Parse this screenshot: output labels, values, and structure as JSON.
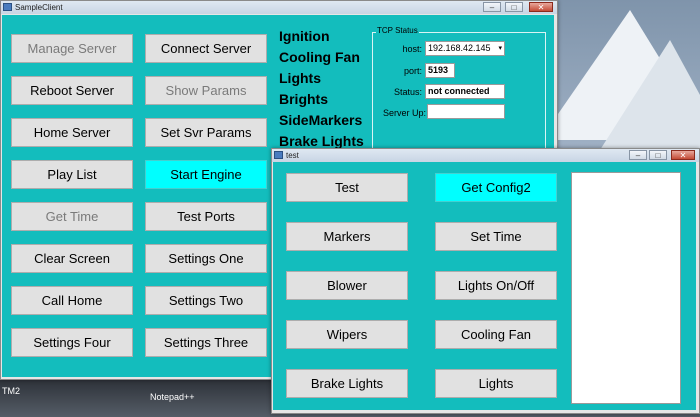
{
  "main_window": {
    "title": "SampleClient",
    "buttons": [
      {
        "label": "Manage Server",
        "state": "disabled"
      },
      {
        "label": "Connect Server",
        "state": "normal"
      },
      {
        "label": "Reboot Server",
        "state": "normal"
      },
      {
        "label": "Show Params",
        "state": "disabled"
      },
      {
        "label": "Home Server",
        "state": "normal"
      },
      {
        "label": "Set Svr Params",
        "state": "normal"
      },
      {
        "label": "Play List",
        "state": "normal"
      },
      {
        "label": "Start Engine",
        "state": "highlighted"
      },
      {
        "label": "Get Time",
        "state": "disabled"
      },
      {
        "label": "Test Ports",
        "state": "normal"
      },
      {
        "label": "Clear Screen",
        "state": "normal"
      },
      {
        "label": "Settings One",
        "state": "normal"
      },
      {
        "label": "Call Home",
        "state": "normal"
      },
      {
        "label": "Settings Two",
        "state": "normal"
      },
      {
        "label": "Settings Four",
        "state": "normal"
      },
      {
        "label": "Settings Three",
        "state": "normal"
      }
    ],
    "status_labels": [
      "Ignition",
      "Cooling Fan",
      "Lights",
      "Brights",
      "SideMarkers",
      "Brake Lights"
    ],
    "tcp_status": {
      "legend": "TCP Status",
      "host_label": "host:",
      "host_value": "192.168.42.145",
      "port_label": "port:",
      "port_value": "5193",
      "status_label": "Status:",
      "status_value": "not connected",
      "server_up_label": "Server Up:",
      "server_up_value": ""
    }
  },
  "test_window": {
    "title": "test",
    "buttons": [
      {
        "label": "Test",
        "state": "normal"
      },
      {
        "label": "Get Config2",
        "state": "highlighted"
      },
      {
        "label": "Markers",
        "state": "normal"
      },
      {
        "label": "Set Time",
        "state": "normal"
      },
      {
        "label": "Blower",
        "state": "normal"
      },
      {
        "label": "Lights On/Off",
        "state": "normal"
      },
      {
        "label": "Wipers",
        "state": "normal"
      },
      {
        "label": "Cooling Fan",
        "state": "normal"
      },
      {
        "label": "Brake Lights",
        "state": "normal"
      },
      {
        "label": "Lights",
        "state": "normal"
      }
    ]
  },
  "desktop": {
    "icon_labels": [
      "TM2",
      "Notepad++"
    ]
  },
  "colors": {
    "client_bg": "#13bdbd",
    "button_bg": "#e1e1e1",
    "highlight_button": "#00ffff",
    "disabled_text": "#7a7a7a"
  }
}
